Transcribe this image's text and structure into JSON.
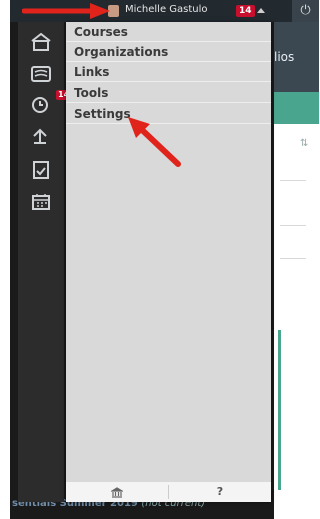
{
  "topbar": {
    "user_name": "Michelle Gastulo",
    "notification_count": "14",
    "power_icon": "power-icon"
  },
  "rail": {
    "icons": [
      "home-icon",
      "list-icon",
      "clock-icon",
      "transfer-icon",
      "document-check-icon",
      "calendar-icon"
    ],
    "alerts_badge": "14"
  },
  "menu": {
    "items": [
      {
        "label": "Courses"
      },
      {
        "label": "Organizations"
      },
      {
        "label": "Links"
      },
      {
        "label": "Tools"
      },
      {
        "label": "Settings"
      }
    ],
    "footer": {
      "home_icon": "institution-icon",
      "help_label": "?"
    }
  },
  "background": {
    "tab_text": "lios",
    "footer_text": "sentials Summer 2019",
    "footer_note": "(not current)"
  },
  "annotations": {
    "arrow_color": "#e1241b"
  }
}
